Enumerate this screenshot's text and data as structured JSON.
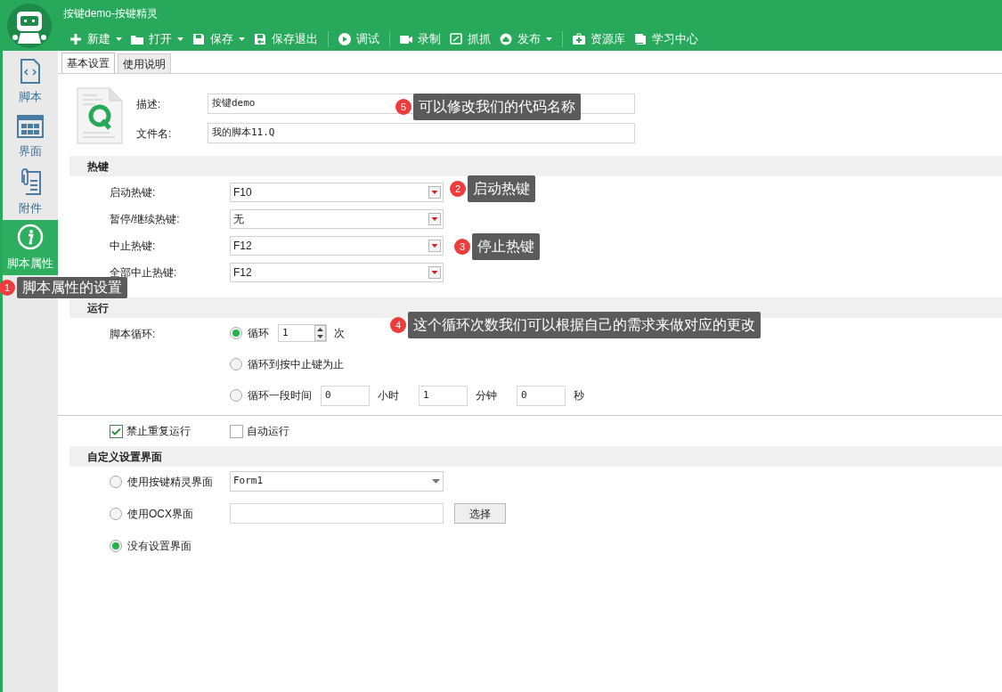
{
  "window": {
    "title": "按键demo-按键精灵"
  },
  "toolbar": [
    {
      "kind": "button",
      "label": "新建",
      "dropdown": true
    },
    {
      "kind": "button",
      "label": "打开",
      "dropdown": true
    },
    {
      "kind": "button",
      "label": "保存",
      "dropdown": true
    },
    {
      "kind": "button",
      "label": "保存退出",
      "dropdown": false
    },
    {
      "kind": "separator"
    },
    {
      "kind": "button",
      "label": "调试",
      "dropdown": false
    },
    {
      "kind": "separator"
    },
    {
      "kind": "button",
      "label": "录制",
      "dropdown": false
    },
    {
      "kind": "button",
      "label": "抓抓",
      "dropdown": false
    },
    {
      "kind": "button",
      "label": "发布",
      "dropdown": true
    },
    {
      "kind": "separator"
    },
    {
      "kind": "button",
      "label": "资源库",
      "dropdown": false
    },
    {
      "kind": "button",
      "label": "学习中心",
      "dropdown": false
    }
  ],
  "sidebar": {
    "items": [
      {
        "label": "脚本",
        "selected": false
      },
      {
        "label": "界面",
        "selected": false
      },
      {
        "label": "附件",
        "selected": false
      },
      {
        "label": "脚本属性",
        "selected": true
      }
    ]
  },
  "tabs": [
    {
      "label": "基本设置",
      "selected": true
    },
    {
      "label": "使用说明",
      "selected": false
    }
  ],
  "file_info": [
    {
      "label": "描述:",
      "value": "按键demo"
    },
    {
      "label": "文件名:",
      "value": "我的脚本11.Q"
    }
  ],
  "hotkeys": {
    "title": "热键",
    "rows": [
      {
        "label": "启动热键:",
        "value": "F10"
      },
      {
        "label": "暂停/继续热键:",
        "value": "无"
      },
      {
        "label": "中止热键:",
        "value": "F12"
      },
      {
        "label": "全部中止热键:",
        "value": "F12"
      }
    ]
  },
  "run": {
    "title": "运行",
    "loop_label": "脚本循环:",
    "options": [
      {
        "kind": "count",
        "label": "循环",
        "value": "1",
        "unit": "次",
        "selected": true
      },
      {
        "kind": "plain",
        "label": "循环到按中止键为止",
        "selected": false
      },
      {
        "kind": "duration",
        "label": "循环一段时间",
        "fields": [
          {
            "value": "0",
            "unit": "小时"
          },
          {
            "value": "1",
            "unit": "分钟"
          },
          {
            "value": "0",
            "unit": "秒"
          }
        ],
        "selected": false
      }
    ]
  },
  "checks": [
    {
      "label": "禁止重复运行",
      "checked": true
    },
    {
      "label": "自动运行",
      "checked": false
    }
  ],
  "custom_ui": {
    "title": "自定义设置界面",
    "options": [
      {
        "kind": "dropdown",
        "label": "使用按键精灵界面",
        "value": "Form1",
        "selected": false
      },
      {
        "kind": "file",
        "label": "使用OCX界面",
        "button": "选择",
        "selected": false
      },
      {
        "kind": "plain",
        "label": "没有设置界面",
        "selected": true
      }
    ]
  },
  "annotations": [
    {
      "number": "5",
      "text": "可以修改我们的代码名称"
    },
    {
      "number": "2",
      "text": "启动热键"
    },
    {
      "number": "3",
      "text": "停止热键"
    },
    {
      "number": "1",
      "text": "脚本属性的设置"
    },
    {
      "number": "4",
      "text": "这个循环次数我们可以根据自己的需求来做对应的更改"
    }
  ]
}
